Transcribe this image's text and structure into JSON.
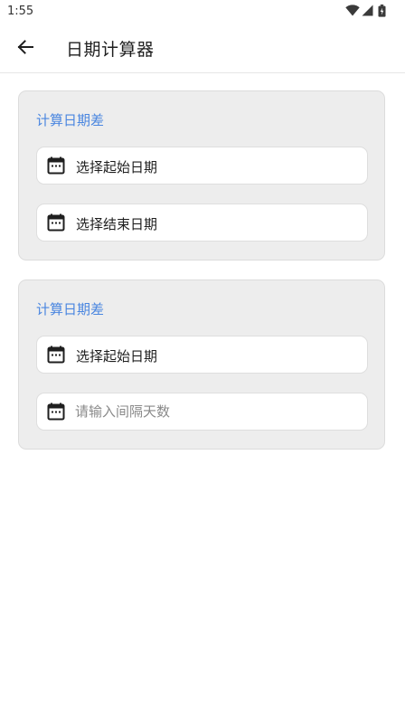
{
  "status_bar": {
    "time": "1:55",
    "icons": [
      "wifi-icon",
      "signal-icon",
      "battery-icon"
    ]
  },
  "header": {
    "back_icon": "arrow-left-icon",
    "title": "日期计算器"
  },
  "cards": [
    {
      "title": "计算日期差",
      "fields": [
        {
          "icon": "calendar-icon",
          "label": "选择起始日期"
        },
        {
          "icon": "calendar-icon",
          "label": "选择结束日期"
        }
      ]
    },
    {
      "title": "计算日期差",
      "fields": [
        {
          "icon": "calendar-icon",
          "label": "选择起始日期"
        },
        {
          "icon": "calendar-icon",
          "value": "",
          "placeholder": "请输入间隔天数"
        }
      ]
    }
  ],
  "colors": {
    "accent": "#4a86e0",
    "card_background": "#ededed",
    "field_background": "#ffffff"
  }
}
